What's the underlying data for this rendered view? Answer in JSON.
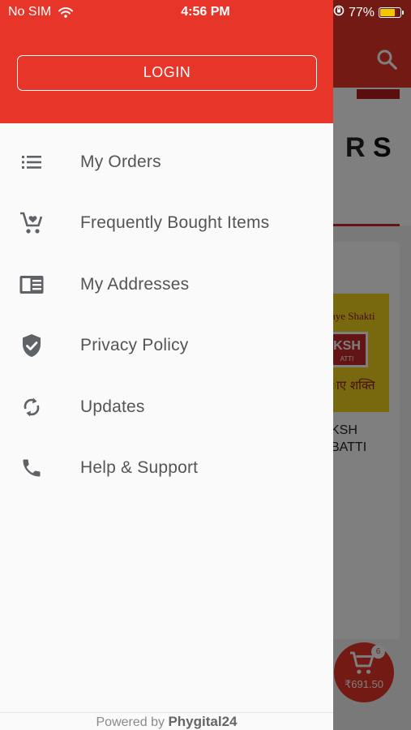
{
  "status_bar": {
    "carrier": "No SIM",
    "time": "4:56 PM",
    "battery": "77%",
    "battery_level": 0.77
  },
  "drawer": {
    "login_label": "LOGIN",
    "menu": [
      {
        "label": "My Orders",
        "icon": "list-icon"
      },
      {
        "label": "Frequently Bought Items",
        "icon": "cart-heart-icon"
      },
      {
        "label": "My Addresses",
        "icon": "address-card-icon"
      },
      {
        "label": "Privacy Policy",
        "icon": "shield-check-icon"
      },
      {
        "label": "Updates",
        "icon": "sync-icon"
      },
      {
        "label": "Help & Support",
        "icon": "phone-icon"
      }
    ],
    "footer_prefix": "Powered by",
    "footer_brand": "Phygital24"
  },
  "background": {
    "banner_letters": [
      "R",
      "S"
    ],
    "product": {
      "tagline": "aye Shakti",
      "brand": "KSH",
      "brand_sub": "ATTI",
      "hindi": "ाए शक्ति",
      "title_line1": "KSH",
      "title_line2": "BATTI"
    },
    "cart": {
      "count": "6",
      "amount": "₹691.50"
    }
  },
  "colors": {
    "accent": "#e8352a",
    "drawer_bg": "#fafafa",
    "menu_text": "#555555",
    "icon": "#5f6368"
  }
}
